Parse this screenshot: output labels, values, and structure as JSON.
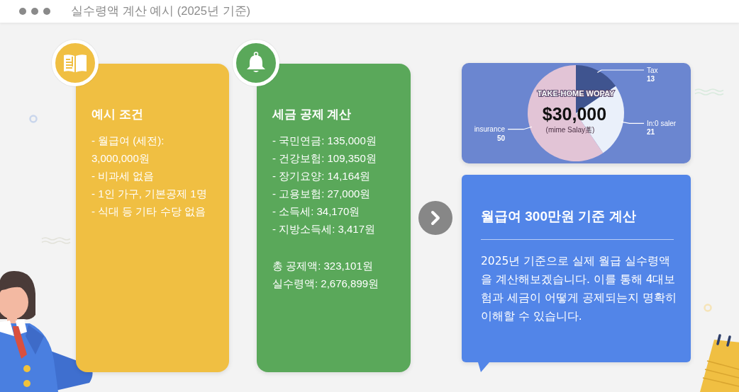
{
  "window": {
    "title": "실수령액 계산 예시 (2025년 기준)"
  },
  "cards": [
    {
      "color": "#f0bf42",
      "title": "예시 조건",
      "items": [
        "- 월급여 (세전): 3,000,000원",
        "- 비과세 없음",
        "- 1인 가구, 기본공제 1명",
        "- 식대 등 기타 수당 없음"
      ]
    },
    {
      "color": "#5aa85a",
      "title": "세금 공제 계산",
      "items": [
        "- 국민연금: 135,000원",
        "- 건강보험: 109,350원",
        "- 장기요양: 14,164원",
        "- 고용보험: 27,000원",
        "- 소득세: 34,170원",
        "- 지방소득세: 3,417원"
      ],
      "totals": [
        "총 공제액: 323,101원",
        "실수령액: 2,676,899원"
      ]
    }
  ],
  "infographic": {
    "heading": "TAKE-HOME WOPAY",
    "amount": "$30,000",
    "caption": "(mime Salay藁)",
    "chart_data": {
      "type": "pie",
      "categories": [
        "Tax",
        "In:0 saler",
        "insurance"
      ],
      "values": [
        13,
        21,
        50
      ],
      "data_labels": true
    }
  },
  "summary": {
    "title": "월급여 300만원 기준 계산",
    "text": "2025년 기준으로 실제 월급 실수령액을 계산해보겠습니다. 이를 통해 4대보험과 세금이 어떻게 공제되는지 명확히 이해할 수 있습니다."
  }
}
